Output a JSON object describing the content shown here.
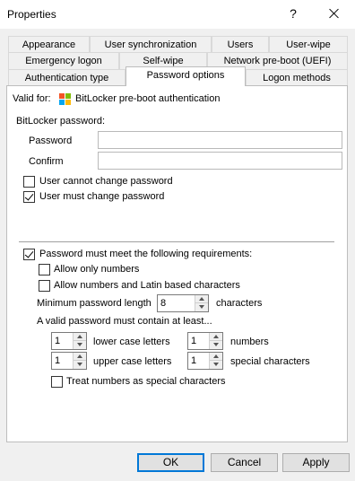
{
  "window": {
    "title": "Properties",
    "help_glyph": "?"
  },
  "tabs": {
    "row1": [
      "Appearance",
      "User synchronization",
      "Users",
      "User-wipe"
    ],
    "row2": [
      "Emergency logon",
      "Self-wipe",
      "Network pre-boot (UEFI)"
    ],
    "row3": [
      "Authentication type",
      "Password options",
      "Logon methods"
    ],
    "active": "Password options"
  },
  "valid_for": {
    "label": "Valid for:",
    "value": "BitLocker pre-boot authentication",
    "icon": "windows-logo-icon",
    "logo_colors": [
      "#f35325",
      "#81bc06",
      "#05a6f0",
      "#ffba08"
    ]
  },
  "bitlocker": {
    "section_label": "BitLocker password:",
    "password_label": "Password",
    "password_value": "",
    "confirm_label": "Confirm",
    "confirm_value": "",
    "cannot_change_label": "User cannot change password",
    "cannot_change_checked": false,
    "must_change_label": "User must change password",
    "must_change_checked": true
  },
  "requirements": {
    "meet_label": "Password must meet the following requirements:",
    "meet_checked": true,
    "only_numbers_label": "Allow only numbers",
    "only_numbers_checked": false,
    "numbers_latin_label": "Allow numbers and Latin based characters",
    "numbers_latin_checked": false,
    "min_length_label": "Minimum password length",
    "min_length_value": "8",
    "min_length_unit": "characters",
    "contain_label": "A valid password must contain at least...",
    "lower_value": "1",
    "lower_label": "lower case letters",
    "numbers_value": "1",
    "numbers_label": "numbers",
    "upper_value": "1",
    "upper_label": "upper case letters",
    "special_value": "1",
    "special_label": "special characters",
    "treat_label": "Treat numbers as special characters",
    "treat_checked": false
  },
  "buttons": {
    "ok": "OK",
    "cancel": "Cancel",
    "apply": "Apply"
  }
}
